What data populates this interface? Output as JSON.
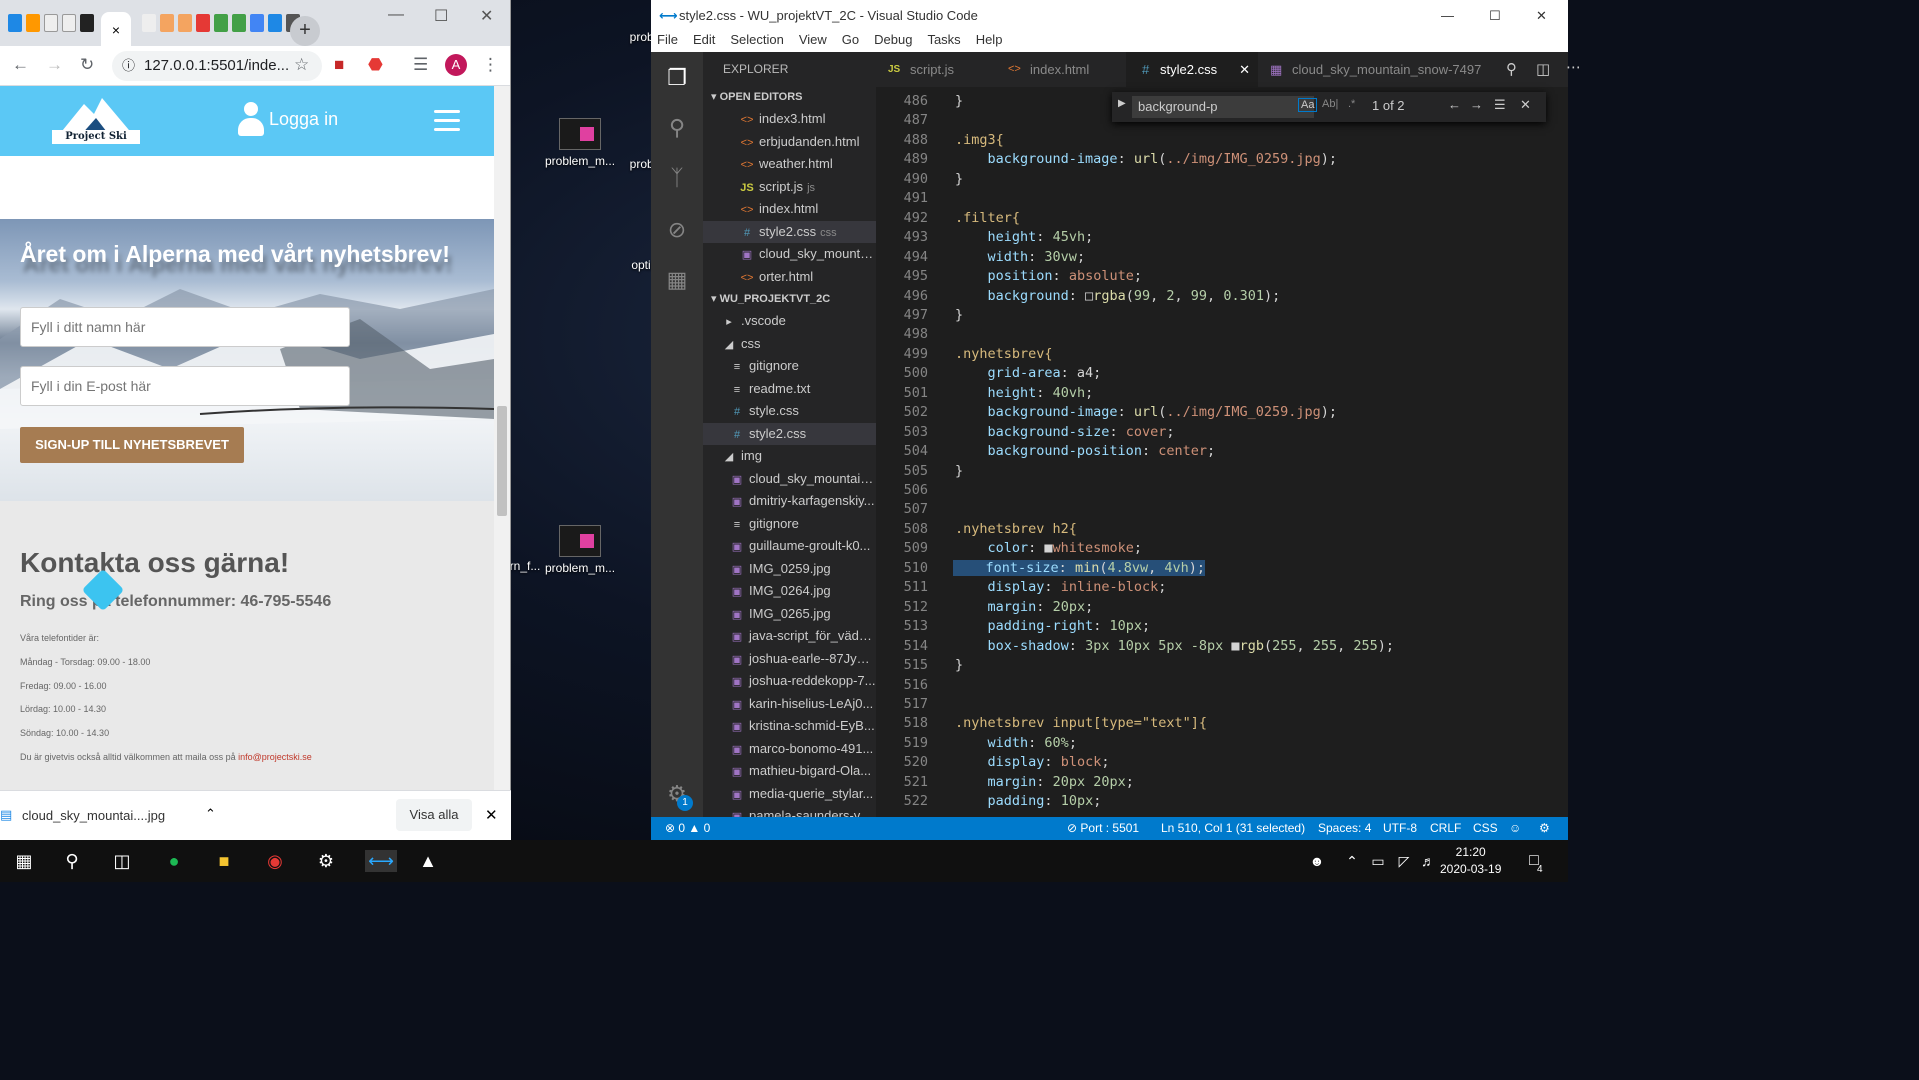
{
  "desktop": {
    "icons": [
      "probl",
      "problem_m...",
      "probl",
      "optir",
      "rn_f...",
      "problem_m..."
    ]
  },
  "chrome": {
    "tab_close": "×",
    "new_tab": "+",
    "url": "127.0.0.1:5501/inde...",
    "avatar": "A",
    "site": {
      "logo_text": "Project Ski",
      "login": "Logga in",
      "hero_title": "Året om i Alperna med vårt nyhetsbrev!",
      "name_placeholder": "Fyll i ditt namn här",
      "email_placeholder": "Fyll i din E-post här",
      "signup": "SIGN-UP TILL NYHETSBREVET",
      "contact_title": "Kontakta oss gärna!",
      "contact_phone": "Ring oss på telefonnummer: 46-795-5546",
      "hours_title": "Våra telefontider är:",
      "hours": [
        "Måndag - Torsdag: 09.00 - 18.00",
        "Fredag: 09.00 - 16.00",
        "Lördag: 10.00 - 14.30",
        "Söndag: 10.00 - 14.30"
      ],
      "mail_text": "Du är givetvis också alltid välkommen att maila oss på ",
      "mail_link": "info@projectski.se"
    },
    "download": {
      "file": "cloud_sky_mountai....jpg",
      "show_all": "Visa alla"
    }
  },
  "vscode": {
    "title": "style2.css - WU_projektVT_2C - Visual Studio Code",
    "menu": [
      "File",
      "Edit",
      "Selection",
      "View",
      "Go",
      "Debug",
      "Tasks",
      "Help"
    ],
    "explorer_title": "EXPLORER",
    "open_editors_label": "OPEN EDITORS",
    "open_editors": [
      {
        "name": "index3.html",
        "type": "html"
      },
      {
        "name": "erbjudanden.html",
        "type": "html"
      },
      {
        "name": "weather.html",
        "type": "html"
      },
      {
        "name": "script.js",
        "type": "js",
        "sub": "js"
      },
      {
        "name": "index.html",
        "type": "html"
      },
      {
        "name": "style2.css",
        "type": "css",
        "sub": "css"
      },
      {
        "name": "cloud_sky_mounta...",
        "type": "img"
      },
      {
        "name": "orter.html",
        "type": "html"
      }
    ],
    "project_label": "WU_PROJEKTVT_2C",
    "tree": [
      {
        "name": ".vscode",
        "type": "folder-closed",
        "indent": 1
      },
      {
        "name": "css",
        "type": "folder-open",
        "indent": 1
      },
      {
        "name": "gitignore",
        "type": "txt",
        "indent": 2
      },
      {
        "name": "readme.txt",
        "type": "txt",
        "indent": 2
      },
      {
        "name": "style.css",
        "type": "css",
        "indent": 2
      },
      {
        "name": "style2.css",
        "type": "css",
        "indent": 2
      },
      {
        "name": "img",
        "type": "folder-open",
        "indent": 1
      },
      {
        "name": "cloud_sky_mountain...",
        "type": "img",
        "indent": 2
      },
      {
        "name": "dmitriy-karfagenskiy...",
        "type": "img",
        "indent": 2
      },
      {
        "name": "gitignore",
        "type": "txt",
        "indent": 2
      },
      {
        "name": "guillaume-groult-k0...",
        "type": "img",
        "indent": 2
      },
      {
        "name": "IMG_0259.jpg",
        "type": "img",
        "indent": 2
      },
      {
        "name": "IMG_0264.jpg",
        "type": "img",
        "indent": 2
      },
      {
        "name": "IMG_0265.jpg",
        "type": "img",
        "indent": 2
      },
      {
        "name": "java-script_för_väde...",
        "type": "img",
        "indent": 2
      },
      {
        "name": "joshua-earle--87JyM...",
        "type": "img",
        "indent": 2
      },
      {
        "name": "joshua-reddekopp-7...",
        "type": "img",
        "indent": 2
      },
      {
        "name": "karin-hiselius-LeAj0...",
        "type": "img",
        "indent": 2
      },
      {
        "name": "kristina-schmid-EyB...",
        "type": "img",
        "indent": 2
      },
      {
        "name": "marco-bonomo-491...",
        "type": "img",
        "indent": 2
      },
      {
        "name": "mathieu-bigard-Ola...",
        "type": "img",
        "indent": 2
      },
      {
        "name": "media-querie_stylar...",
        "type": "img",
        "indent": 2
      },
      {
        "name": "pamela-saunders-yV...",
        "type": "img",
        "indent": 2
      }
    ],
    "tabs": [
      {
        "label": "script.js",
        "icon": "JS"
      },
      {
        "label": "index.html",
        "icon": "<>"
      },
      {
        "label": "style2.css",
        "icon": "#"
      },
      {
        "label": "cloud_sky_mountain_snow-7497",
        "icon": "img"
      }
    ],
    "find": {
      "query": "background-p",
      "match_case": "Aa",
      "whole_word": "Ab|",
      "regex": ".*",
      "count": "1 of 2"
    },
    "first_line": 486,
    "lines": [
      [
        [
          "t",
          "}"
        ]
      ],
      [],
      [
        [
          "s",
          ".img3{"
        ]
      ],
      [
        [
          "t",
          "    "
        ],
        [
          "p",
          "background-image"
        ],
        [
          "t",
          ": "
        ],
        [
          "f",
          "url"
        ],
        [
          "t",
          "("
        ],
        [
          "v",
          "../img/IMG_0259.jpg"
        ],
        [
          "t",
          ");"
        ]
      ],
      [
        [
          "t",
          "}"
        ]
      ],
      [],
      [
        [
          "s",
          ".filter{"
        ]
      ],
      [
        [
          "t",
          "    "
        ],
        [
          "p",
          "height"
        ],
        [
          "t",
          ": "
        ],
        [
          "n",
          "45vh"
        ],
        [
          "t",
          ";"
        ]
      ],
      [
        [
          "t",
          "    "
        ],
        [
          "p",
          "width"
        ],
        [
          "t",
          ": "
        ],
        [
          "n",
          "30vw"
        ],
        [
          "t",
          ";"
        ]
      ],
      [
        [
          "t",
          "    "
        ],
        [
          "p",
          "position"
        ],
        [
          "t",
          ": "
        ],
        [
          "v",
          "absolute"
        ],
        [
          "t",
          ";"
        ]
      ],
      [
        [
          "t",
          "    "
        ],
        [
          "p",
          "background"
        ],
        [
          "t",
          ": □"
        ],
        [
          "f",
          "rgba"
        ],
        [
          "t",
          "("
        ],
        [
          "n",
          "99"
        ],
        [
          "t",
          ", "
        ],
        [
          "n",
          "2"
        ],
        [
          "t",
          ", "
        ],
        [
          "n",
          "99"
        ],
        [
          "t",
          ", "
        ],
        [
          "n",
          "0.301"
        ],
        [
          "t",
          ");"
        ]
      ],
      [
        [
          "t",
          "}"
        ]
      ],
      [],
      [
        [
          "s",
          ".nyhetsbrev{"
        ]
      ],
      [
        [
          "t",
          "    "
        ],
        [
          "p",
          "grid-area"
        ],
        [
          "t",
          ": a4;"
        ]
      ],
      [
        [
          "t",
          "    "
        ],
        [
          "p",
          "height"
        ],
        [
          "t",
          ": "
        ],
        [
          "n",
          "40vh"
        ],
        [
          "t",
          ";"
        ]
      ],
      [
        [
          "t",
          "    "
        ],
        [
          "p",
          "background-image"
        ],
        [
          "t",
          ": "
        ],
        [
          "f",
          "url"
        ],
        [
          "t",
          "("
        ],
        [
          "v",
          "../img/IMG_0259.jpg"
        ],
        [
          "t",
          ");"
        ]
      ],
      [
        [
          "t",
          "    "
        ],
        [
          "p",
          "background-size"
        ],
        [
          "t",
          ": "
        ],
        [
          "v",
          "cover"
        ],
        [
          "t",
          ";"
        ]
      ],
      [
        [
          "t",
          "    "
        ],
        [
          "p",
          "background-position"
        ],
        [
          "t",
          ": "
        ],
        [
          "v",
          "center"
        ],
        [
          "t",
          ";"
        ]
      ],
      [
        [
          "t",
          "}"
        ]
      ],
      [],
      [],
      [
        [
          "s",
          ".nyhetsbrev h2{"
        ]
      ],
      [
        [
          "t",
          "    "
        ],
        [
          "p",
          "color"
        ],
        [
          "t",
          ": ■"
        ],
        [
          "v",
          "whitesmoke"
        ],
        [
          "t",
          ";"
        ]
      ],
      [
        [
          "t",
          "    "
        ],
        [
          "p",
          "font-size"
        ],
        [
          "t",
          ": "
        ],
        [
          "f",
          "min"
        ],
        [
          "t",
          "("
        ],
        [
          "n",
          "4.8vw"
        ],
        [
          "t",
          ", "
        ],
        [
          "n",
          "4vh"
        ],
        [
          "t",
          ");"
        ]
      ],
      [
        [
          "t",
          "    "
        ],
        [
          "p",
          "display"
        ],
        [
          "t",
          ": "
        ],
        [
          "v",
          "inline-block"
        ],
        [
          "t",
          ";"
        ]
      ],
      [
        [
          "t",
          "    "
        ],
        [
          "p",
          "margin"
        ],
        [
          "t",
          ": "
        ],
        [
          "n",
          "20px"
        ],
        [
          "t",
          ";"
        ]
      ],
      [
        [
          "t",
          "    "
        ],
        [
          "p",
          "padding-right"
        ],
        [
          "t",
          ": "
        ],
        [
          "n",
          "10px"
        ],
        [
          "t",
          ";"
        ]
      ],
      [
        [
          "t",
          "    "
        ],
        [
          "p",
          "box-shadow"
        ],
        [
          "t",
          ": "
        ],
        [
          "n",
          "3px"
        ],
        [
          "t",
          " "
        ],
        [
          "n",
          "10px"
        ],
        [
          "t",
          " "
        ],
        [
          "n",
          "5px"
        ],
        [
          "t",
          " "
        ],
        [
          "n",
          "-8px"
        ],
        [
          "t",
          " ■"
        ],
        [
          "f",
          "rgb"
        ],
        [
          "t",
          "("
        ],
        [
          "n",
          "255"
        ],
        [
          "t",
          ", "
        ],
        [
          "n",
          "255"
        ],
        [
          "t",
          ", "
        ],
        [
          "n",
          "255"
        ],
        [
          "t",
          ");"
        ]
      ],
      [
        [
          "t",
          "}"
        ]
      ],
      [],
      [],
      [
        [
          "s",
          ".nyhetsbrev input[type=\"text\"]{"
        ]
      ],
      [
        [
          "t",
          "    "
        ],
        [
          "p",
          "width"
        ],
        [
          "t",
          ": "
        ],
        [
          "n",
          "60%"
        ],
        [
          "t",
          ";"
        ]
      ],
      [
        [
          "t",
          "    "
        ],
        [
          "p",
          "display"
        ],
        [
          "t",
          ": "
        ],
        [
          "v",
          "block"
        ],
        [
          "t",
          ";"
        ]
      ],
      [
        [
          "t",
          "    "
        ],
        [
          "p",
          "margin"
        ],
        [
          "t",
          ": "
        ],
        [
          "n",
          "20px"
        ],
        [
          "t",
          " "
        ],
        [
          "n",
          "20px"
        ],
        [
          "t",
          ";"
        ]
      ],
      [
        [
          "t",
          "    "
        ],
        [
          "p",
          "padding"
        ],
        [
          "t",
          ": "
        ],
        [
          "n",
          "10px"
        ],
        [
          "t",
          ";"
        ]
      ]
    ],
    "status": {
      "errors": "0",
      "warnings": "0",
      "port": "Port : 5501",
      "position": "Ln 510, Col 1 (31 selected)",
      "spaces": "Spaces: 4",
      "encoding": "UTF-8",
      "eol": "CRLF",
      "language": "CSS"
    },
    "settings_badge": "1"
  },
  "taskbar": {
    "time": "21:20",
    "date": "2020-03-19",
    "notifications": "4"
  }
}
